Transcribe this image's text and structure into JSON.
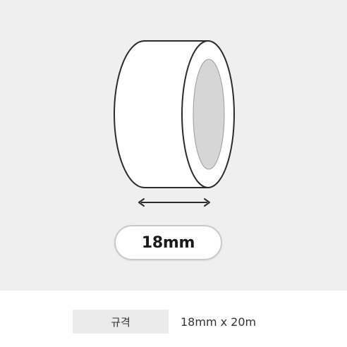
{
  "product": {
    "size_badge": "18mm",
    "arrow_icon": "double-arrow-icon",
    "tape_icon": "tape-roll-icon"
  },
  "spec": {
    "label": "규격",
    "value": "18mm x 20m"
  },
  "colors": {
    "panel_bg": "#efefef",
    "tape_fill": "#ffffff",
    "tape_outline": "#2b2b2b",
    "core": "#d6d6d6"
  }
}
